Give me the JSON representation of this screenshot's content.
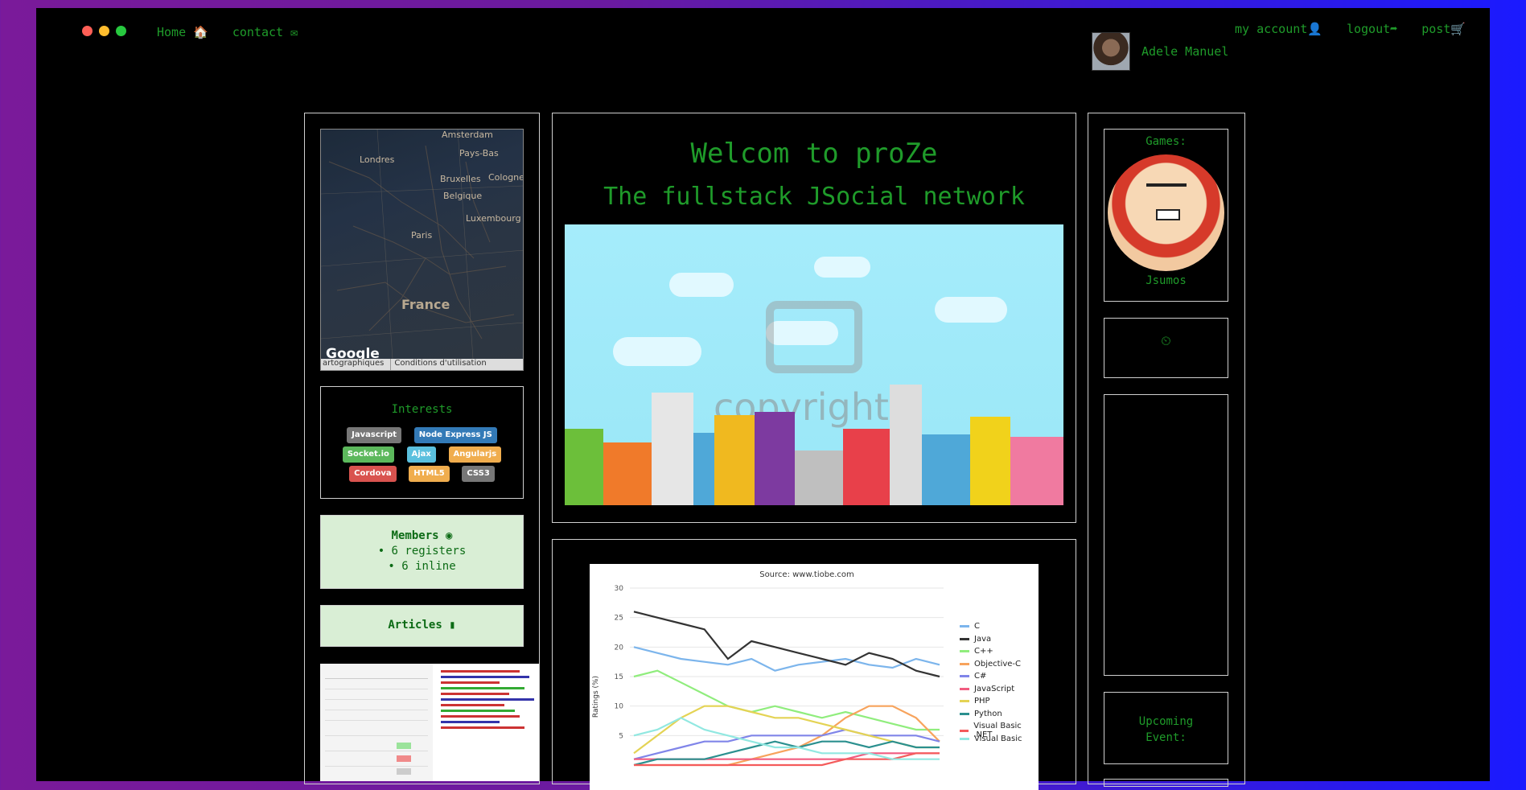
{
  "window": {
    "dot_colors": [
      "#ff5f56",
      "#ffbd2e",
      "#27c93f"
    ]
  },
  "nav": {
    "home": "Home 🏠",
    "contact": "contact ✉",
    "account": "my account👤",
    "logout": "logout➦",
    "post": "post🛒"
  },
  "user": {
    "name": "Adele Manuel"
  },
  "map": {
    "cities": [
      "Amsterdam",
      "Londres",
      "Pays-Bas",
      "Bruxelles",
      "Belgique",
      "Cologne",
      "Luxembourg",
      "Paris",
      "France"
    ],
    "logo": "Google",
    "footer_left": "artographiques",
    "footer_right": "Conditions d'utilisation"
  },
  "interests": {
    "title": "Interests",
    "tags": [
      {
        "label": "Javascript",
        "color": "#777777"
      },
      {
        "label": "Node Express JS",
        "color": "#337ab7"
      },
      {
        "label": "Socket.io",
        "color": "#5cb85c"
      },
      {
        "label": "Ajax",
        "color": "#5bc0de"
      },
      {
        "label": "Angularjs",
        "color": "#f0ad4e"
      },
      {
        "label": "Cordova",
        "color": "#d9534f"
      },
      {
        "label": "HTML5",
        "color": "#f0ad4e"
      },
      {
        "label": "CSS3",
        "color": "#777777"
      }
    ]
  },
  "members": {
    "title": "Members",
    "icon": "globe-icon",
    "registers": "• 6 registers",
    "inline": "• 6 inline"
  },
  "articles": {
    "title": "Articles",
    "icon": "file-icon"
  },
  "welcome": {
    "title": "Welcom to proZe",
    "subtitle": "The fullstack JSocial network",
    "watermark": "copyright"
  },
  "chart_data": {
    "type": "line",
    "title": "Source: www.tiobe.com",
    "ylabel": "Ratings (%)",
    "ylim": [
      0,
      30
    ],
    "y_ticks": [
      5,
      10,
      15,
      20,
      25,
      30
    ],
    "series": [
      {
        "name": "C",
        "color": "#7cb5ec",
        "values": [
          20,
          19,
          18,
          17.5,
          17,
          18,
          16,
          17,
          17.5,
          18,
          17,
          16.5,
          18,
          17
        ]
      },
      {
        "name": "Java",
        "color": "#333333",
        "values": [
          26,
          25,
          24,
          23,
          18,
          21,
          20,
          19,
          18,
          17,
          19,
          18,
          16,
          15
        ]
      },
      {
        "name": "C++",
        "color": "#90ed7d",
        "values": [
          15,
          16,
          14,
          12,
          10,
          9,
          10,
          9,
          8,
          9,
          8,
          7,
          6,
          6
        ]
      },
      {
        "name": "Objective-C",
        "color": "#f7a35c",
        "values": [
          0,
          0,
          0,
          0,
          0,
          1,
          2,
          3,
          5,
          8,
          10,
          10,
          8,
          4
        ]
      },
      {
        "name": "C#",
        "color": "#8085e9",
        "values": [
          1,
          2,
          3,
          4,
          4,
          5,
          5,
          5,
          5,
          6,
          5,
          5,
          5,
          4
        ]
      },
      {
        "name": "JavaScript",
        "color": "#f15c80",
        "values": [
          1,
          1,
          1,
          1,
          1,
          1,
          1,
          1,
          1,
          1,
          2,
          2,
          2,
          2
        ]
      },
      {
        "name": "PHP",
        "color": "#e4d354",
        "values": [
          2,
          5,
          8,
          10,
          10,
          9,
          8,
          8,
          7,
          6,
          5,
          4,
          3,
          3
        ]
      },
      {
        "name": "Python",
        "color": "#2b908f",
        "values": [
          0,
          1,
          1,
          1,
          2,
          3,
          4,
          3,
          4,
          4,
          3,
          4,
          3,
          3
        ]
      },
      {
        "name": "Visual Basic .NET",
        "color": "#f45b5b",
        "values": [
          0,
          0,
          0,
          0,
          0,
          0,
          0,
          0,
          0,
          1,
          1,
          1,
          2,
          2
        ]
      },
      {
        "name": "Visual Basic",
        "color": "#91e8e1",
        "values": [
          5,
          6,
          8,
          6,
          5,
          4,
          3,
          3,
          2,
          2,
          2,
          1,
          1,
          1
        ]
      }
    ]
  },
  "games": {
    "title": "Games:",
    "name": "Jsumos",
    "info_icon": "clock-icon",
    "info_text": "⏲"
  },
  "events": {
    "title": "Upcoming Event:"
  }
}
